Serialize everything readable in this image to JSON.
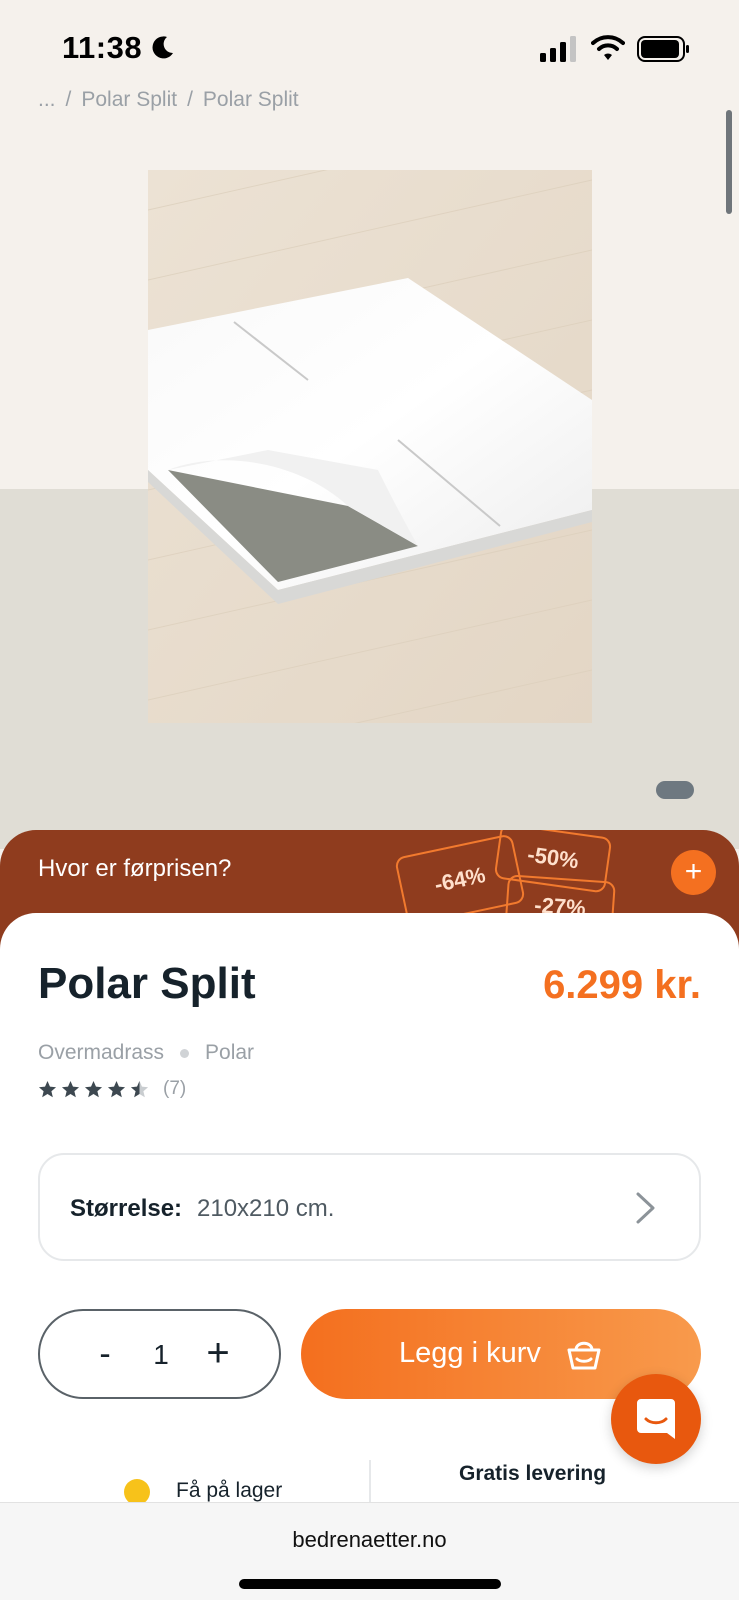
{
  "status_bar": {
    "time": "11:38"
  },
  "breadcrumb": {
    "ellipsis": "...",
    "separator": "/",
    "items": [
      "Polar Split",
      "Polar Split"
    ]
  },
  "gallery": {
    "image_alt": "Polar Split"
  },
  "prior_price_banner": {
    "text": "Hvor er førprisen?",
    "tags": [
      "-64%",
      "-50%",
      "-27%"
    ],
    "expand": "+"
  },
  "product": {
    "title": "Polar Split",
    "price": "6.299 kr.",
    "category": "Overmadrass",
    "brand": "Polar",
    "rating": 4.5,
    "review_count": "(7)"
  },
  "size": {
    "label": "Størrelse:",
    "value": "210x210 cm."
  },
  "quantity": {
    "minus": "-",
    "value": "1",
    "plus": "+"
  },
  "cart": {
    "label": "Legg i kurv"
  },
  "stock": {
    "label": "Få på lager"
  },
  "delivery": {
    "label": "Gratis levering"
  },
  "browser": {
    "url": "bedrenaetter.no"
  },
  "colors": {
    "accent": "#f47020",
    "banner": "#8f3c1e",
    "stock_dot": "#f7c21a",
    "text": "#16222b"
  }
}
